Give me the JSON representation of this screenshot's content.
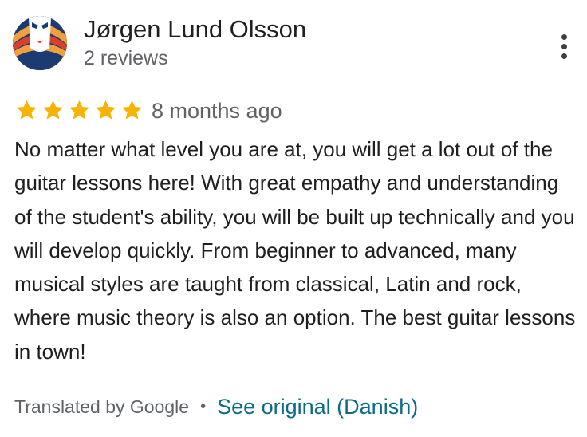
{
  "reviewer": {
    "name": "Jørgen Lund Olsson",
    "reviews_count": "2 reviews",
    "avatar_icon": "abstract-face-avatar-icon"
  },
  "menu": {
    "icon": "more-vert-icon"
  },
  "rating": {
    "stars": 5,
    "max": 5,
    "star_color": "#f6b400"
  },
  "review": {
    "time": "8 months ago",
    "text": "No matter what level you are at, you will get a lot out of the guitar lessons here! With great empathy and understanding of the student's ability, you will be built up technically and you will develop quickly. From beginner to advanced, many musical styles are taught from classical, Latin and rock, where music theory is also an option. The best guitar lessons in town!"
  },
  "footer": {
    "translated": "Translated by Google",
    "separator": "•",
    "see_original": "See original (Danish)",
    "link_color": "#0b6b88"
  }
}
